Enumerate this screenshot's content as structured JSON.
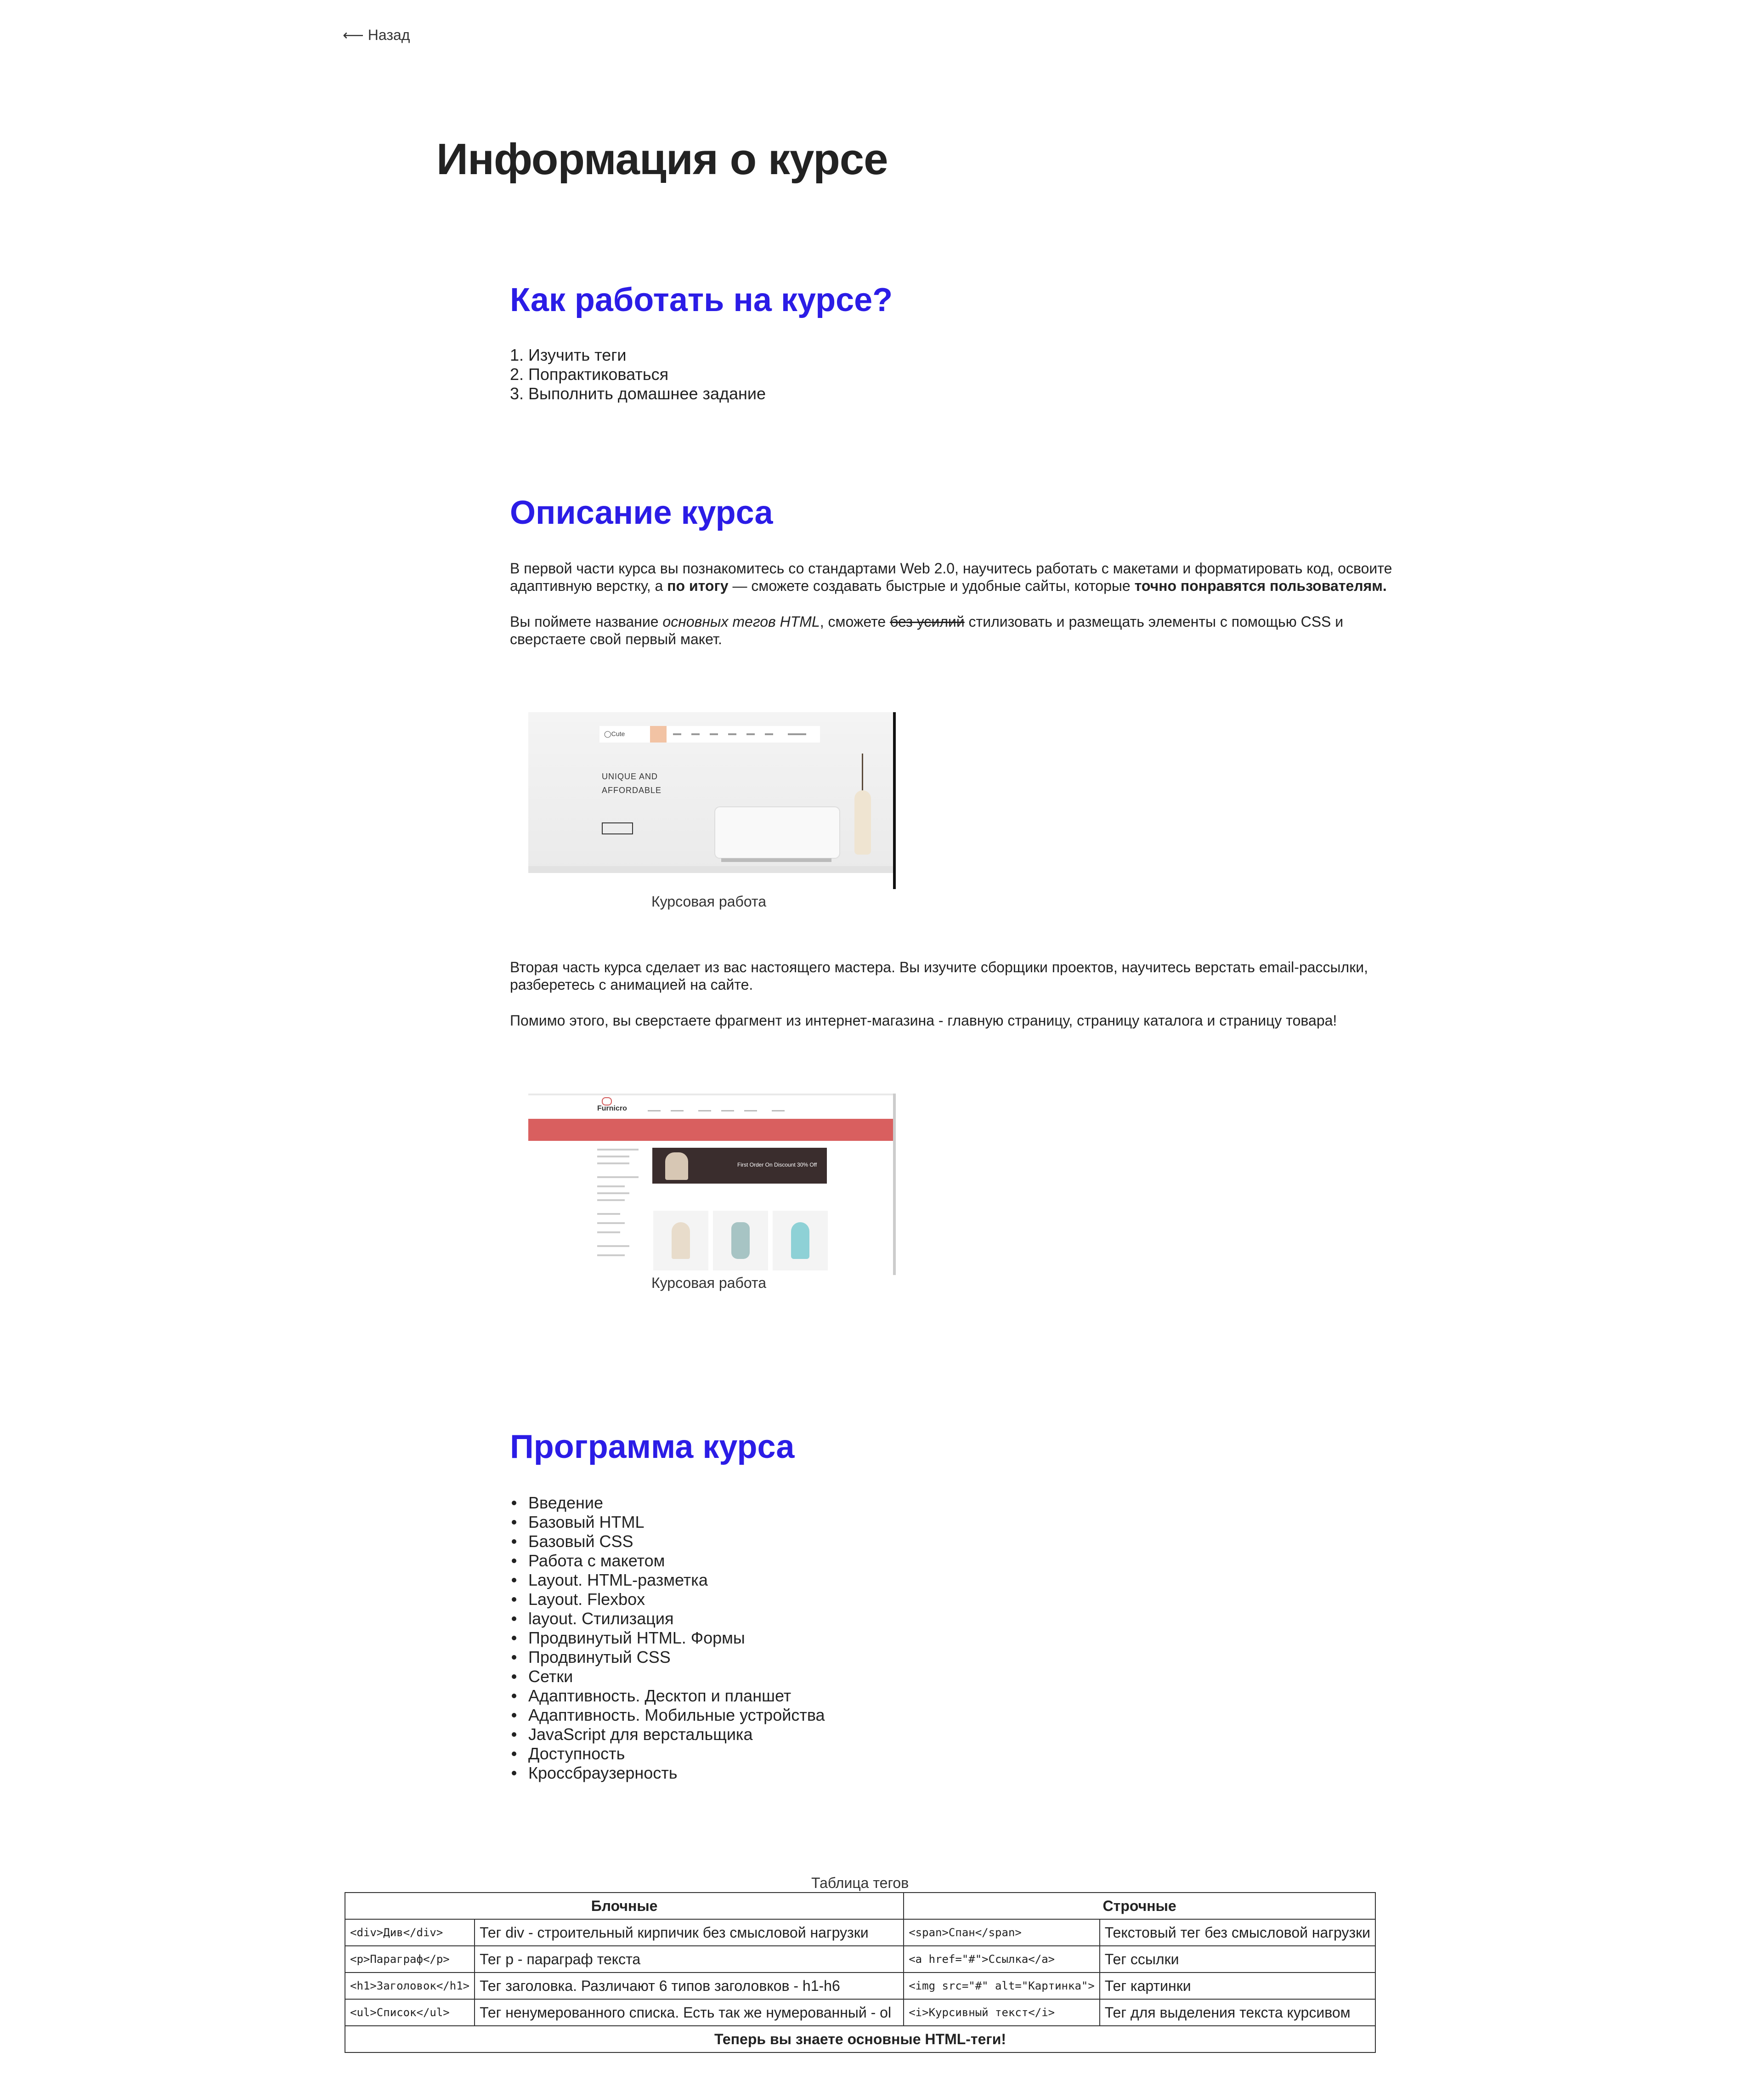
{
  "nav": {
    "back_label": "⟵ Назад"
  },
  "page_title": "Информация о курсе",
  "how_to": {
    "title": "Как работать на курсе?",
    "steps": [
      "1. Изучить теги",
      "2. Попрактиковаться",
      "3. Выполнить домашнее задание"
    ]
  },
  "description": {
    "title": "Описание курса",
    "p1_a": "В первой части курса вы познакомитесь со стандартами Web 2.0, научитесь работать с макетами и форматировать код, освоите адаптивную верстку, а ",
    "p1_b": "по итогу",
    "p1_c": " — сможете создавать быстрые и удобные сайты, которые ",
    "p1_d": "точно понравятся пользователям.",
    "p2_a": "Вы поймете название ",
    "p2_b": "основных тегов HTML",
    "p2_c": ", сможете ",
    "p2_d": "без усилий",
    "p2_e": " стилизовать и размещать элементы с помощью CSS и сверстаете свой первый макет.",
    "figure1": {
      "caption": "Курсовая работа",
      "logo": "◯Cute",
      "hero_line1": "UNIQUE AND",
      "hero_line2": "AFFORDABLE"
    },
    "p3": "Вторая часть курса сделает из вас настоящего мастера. Вы изучите сборщики проектов, научитесь верстать email-рассылки, разберетесь с анимацией на сайте.",
    "p4": "Помимо этого, вы сверстаете фрагмент из интернет-магазина - главную страницу, страницу каталога и страницу товара!",
    "figure2": {
      "caption": "Курсовая работа",
      "brand": "Furnicro",
      "banner_text": "First Order On Discount 30% Off"
    }
  },
  "program": {
    "title": "Программа курса",
    "items": [
      "Введение",
      "Базовый HTML",
      "Базовый CSS",
      "Работа с макетом",
      "Layout. HTML-разметка",
      "Layout. Flexbox",
      "layout. Стилизация",
      "Продвинутый HTML. Формы",
      "Продвинутый CSS",
      "Сетки",
      "Адаптивность. Десктоп и планшет",
      "Адаптивность. Мобильные устройства",
      "JavaScript для верстальщика",
      "Доступность",
      "Кроссбраузерность"
    ]
  },
  "tags_table": {
    "caption": "Таблица тегов",
    "block_header": "Блочные",
    "inline_header": "Строчные",
    "rows": [
      {
        "block_code": "<div>Див</div>",
        "block_desc": "Тег div - строительный кирпичик без смысловой нагрузки",
        "inline_code": "<span>Спан</span>",
        "inline_desc": "Текстовый тег без смысловой нагрузки"
      },
      {
        "block_code": "<p>Параграф</p>",
        "block_desc": "Тег p - параграф текста",
        "inline_code": "<a href=\"#\">Ссылка</a>",
        "inline_desc": "Тег ссылки"
      },
      {
        "block_code": "<h1>Заголовок</h1>",
        "block_desc": "Тег заголовка. Различают 6 типов заголовков - h1-h6",
        "inline_code": "<img src=\"#\" alt=\"Картинка\">",
        "inline_desc": "Тег картинки"
      },
      {
        "block_code": "<ul>Список</ul>",
        "block_desc": "Тег ненумерованного списка. Есть так же нумерованный - ol",
        "inline_code": "<i>Курсивный текст</i>",
        "inline_desc": "Тег для выделения текста курсивом"
      }
    ],
    "footer": "Теперь вы знаете основные HTML-теги!"
  },
  "colors": {
    "accent": "#2b1ce6",
    "text": "#222222",
    "shop_red": "#d95f5f",
    "hero_peach": "#f2c3a4"
  }
}
